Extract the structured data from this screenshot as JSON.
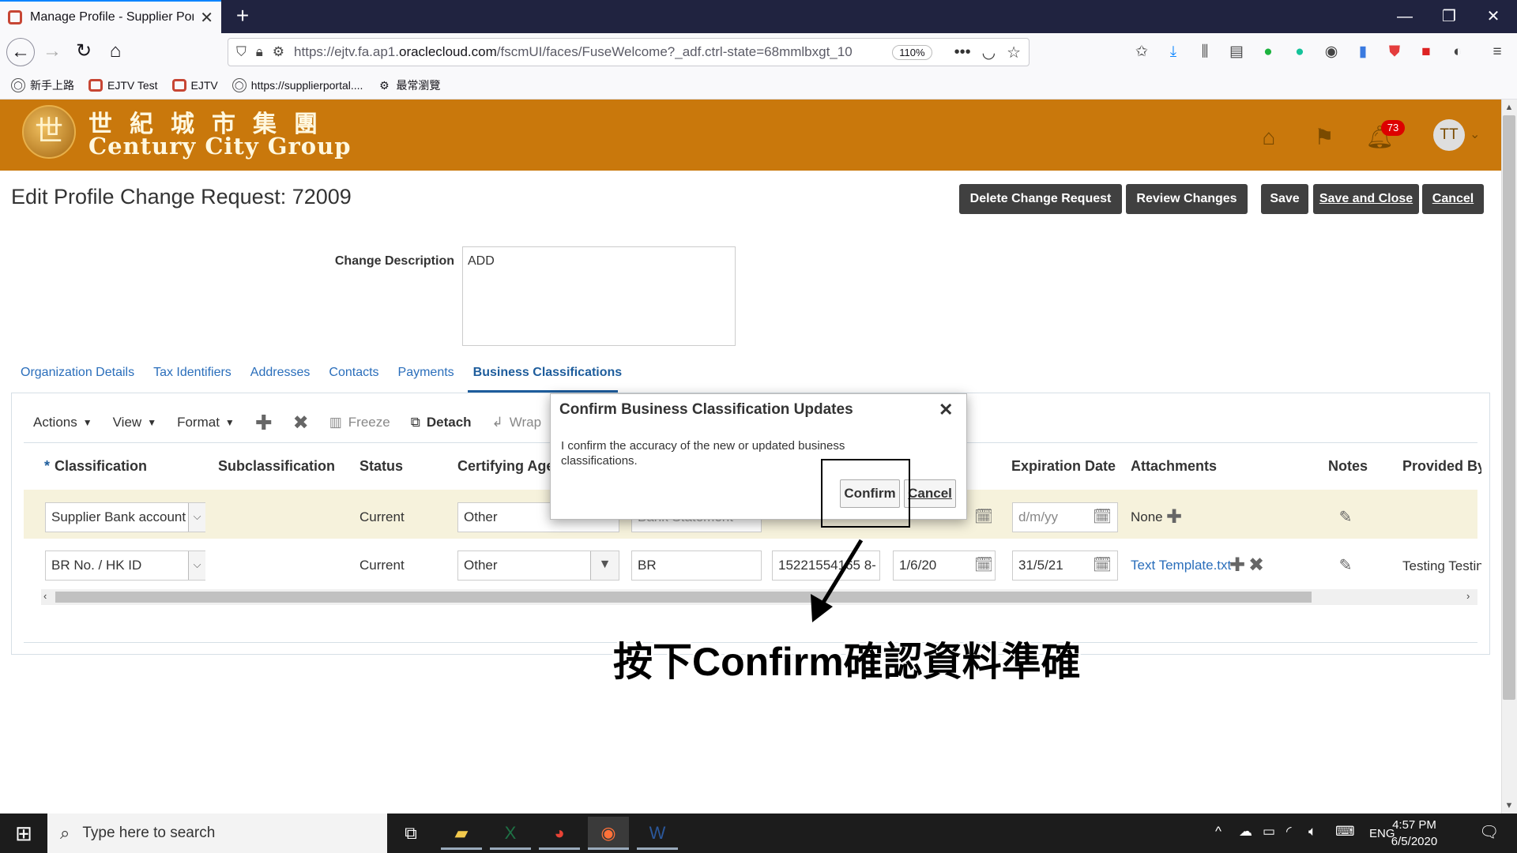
{
  "browser": {
    "tab_title": "Manage Profile - Supplier Portal",
    "url": "https://ejtv.fa.ap1.oraclecloud.com/fscmUI/faces/FuseWelcome?_adf.ctrl-state=68mmlbxgt_10",
    "url_prefix": "https://ejtv.fa.ap1.",
    "url_domain": "oraclecloud.com",
    "url_suffix": "/fscmUI/faces/FuseWelcome?_adf.ctrl-state=68mmlbxgt_10",
    "zoom": "110%",
    "bookmarks": [
      "新手上路",
      "EJTV Test",
      "EJTV",
      "https://supplierportal....",
      "最常瀏覽"
    ]
  },
  "banner": {
    "logo_chinese": "世紀城市集團",
    "logo_english": "Century City Group",
    "notification_count": "73",
    "avatar_initials": "TT"
  },
  "page": {
    "title": "Edit Profile Change Request: 72009",
    "buttons": [
      "Delete Change Request",
      "Review Changes",
      "Save",
      "Save and Close",
      "Cancel"
    ],
    "change_description_label": "Change Description",
    "change_description_value": "ADD",
    "tabs": [
      "Organization Details",
      "Tax Identifiers",
      "Addresses",
      "Contacts",
      "Payments",
      "Business Classifications"
    ],
    "active_tab": "Business Classifications"
  },
  "toolbar": {
    "actions": "Actions",
    "view": "View",
    "format": "Format",
    "freeze": "Freeze",
    "detach": "Detach",
    "wrap": "Wrap"
  },
  "table": {
    "required_marker": "*",
    "columns": [
      "Classification",
      "Subclassification",
      "Status",
      "Certifying Age",
      "Expiration Date",
      "Attachments",
      "Notes",
      "Provided By"
    ],
    "rows": [
      {
        "classification": "Supplier Bank account s",
        "status": "Current",
        "certifying_agency": "Other",
        "other_agency": "Bank Statement",
        "expiration_date_placeholder": "d/m/yy",
        "start_date_placeholder": "d/m/yy",
        "attachments": "None"
      },
      {
        "classification": "BR No. / HK ID",
        "status": "Current",
        "certifying_agency": "Other",
        "other_agency": "BR",
        "certificate_number": "15221554165 8-",
        "start_date": "1/6/20",
        "expiration_date": "31/5/21",
        "attachments": "Text Template.txt",
        "provided_by": "Testing Testin"
      }
    ]
  },
  "dialog": {
    "title": "Confirm Business Classification Updates",
    "body": "I confirm the accuracy of the new or updated business classifications.",
    "confirm_label": "Confirm",
    "cancel_label": "Cancel"
  },
  "annotation": {
    "caption": "按下Confirm確認資料準確"
  },
  "taskbar": {
    "search_placeholder": "Type here to search",
    "language": "ENG",
    "time": "4:57 PM",
    "date": "6/5/2020"
  },
  "colors": {
    "banner": "#c9780c",
    "button_dark": "#404040",
    "link": "#2a6ebb",
    "row_highlight": "#f6f2dc"
  }
}
